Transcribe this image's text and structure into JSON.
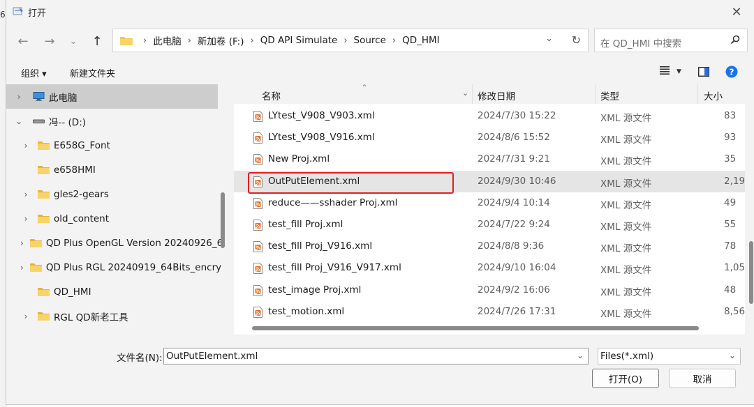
{
  "window": {
    "title": "打开",
    "stray_text": "6"
  },
  "address": {
    "crumbs": [
      "此电脑",
      "新加卷 (F:)",
      "QD API Simulate",
      "Source",
      "QD_HMI"
    ]
  },
  "search": {
    "placeholder": "在 QD_HMI 中搜索"
  },
  "toolbar": {
    "organize": "组织 ▾",
    "new_folder": "新建文件夹"
  },
  "nav": {
    "items": [
      {
        "label": "此电脑",
        "icon": "pc-icon",
        "expand": "›",
        "selected": true
      },
      {
        "label": "冯-- (D:)",
        "icon": "drive-icon",
        "expand": "⌄"
      },
      {
        "label": "E658G_Font",
        "icon": "folder-icon",
        "expand": "›"
      },
      {
        "label": "e658HMI",
        "icon": "folder-icon",
        "expand": ""
      },
      {
        "label": "gles2-gears",
        "icon": "folder-icon",
        "expand": "›"
      },
      {
        "label": "old_content",
        "icon": "folder-icon",
        "expand": "›"
      },
      {
        "label": "QD Plus OpenGL Version 20240926_6",
        "icon": "folder-icon",
        "expand": "›"
      },
      {
        "label": "QD Plus RGL 20240919_64Bits_encry",
        "icon": "folder-icon",
        "expand": "›"
      },
      {
        "label": "QD_HMI",
        "icon": "folder-icon",
        "expand": ""
      },
      {
        "label": "RGL QD新老工具",
        "icon": "folder-icon",
        "expand": "›"
      }
    ]
  },
  "columns": {
    "name": "名称",
    "date": "修改日期",
    "type": "类型",
    "size": "大小"
  },
  "files": [
    {
      "name": "LYtest_V908_V903.xml",
      "date": "2024/7/30 15:22",
      "type": "XML 源文件",
      "size": "83"
    },
    {
      "name": "LYtest_V908_V916.xml",
      "date": "2024/8/6 15:52",
      "type": "XML 源文件",
      "size": "93"
    },
    {
      "name": "New Proj.xml",
      "date": "2024/7/31 9:21",
      "type": "XML 源文件",
      "size": "35"
    },
    {
      "name": "OutPutElement.xml",
      "date": "2024/9/30 10:46",
      "type": "XML 源文件",
      "size": "2,19",
      "selected": true
    },
    {
      "name": "reduce——sshader Proj.xml",
      "date": "2024/9/4 10:14",
      "type": "XML 源文件",
      "size": "49"
    },
    {
      "name": "test_fill Proj.xml",
      "date": "2024/7/22 9:24",
      "type": "XML 源文件",
      "size": "55"
    },
    {
      "name": "test_fill Proj_V916.xml",
      "date": "2024/8/8 9:36",
      "type": "XML 源文件",
      "size": "78"
    },
    {
      "name": "test_fill Proj_V916_V917.xml",
      "date": "2024/9/10 16:04",
      "type": "XML 源文件",
      "size": "1,05"
    },
    {
      "name": "test_image Proj.xml",
      "date": "2024/9/2 16:06",
      "type": "XML 源文件",
      "size": "48"
    },
    {
      "name": "test_motion.xml",
      "date": "2024/7/26 17:31",
      "type": "XML 源文件",
      "size": "8,56"
    }
  ],
  "footer": {
    "filename_label": "文件名(N):",
    "filename_value": "OutPutElement.xml",
    "filetype_value": "Files(*.xml)",
    "open_label": "打开(O)",
    "cancel_label": "取消"
  },
  "colors": {
    "highlight_box": "#e02020",
    "folder": "#f4c64a",
    "help": "#1a73e8",
    "xml_icon": "#e2742b"
  }
}
